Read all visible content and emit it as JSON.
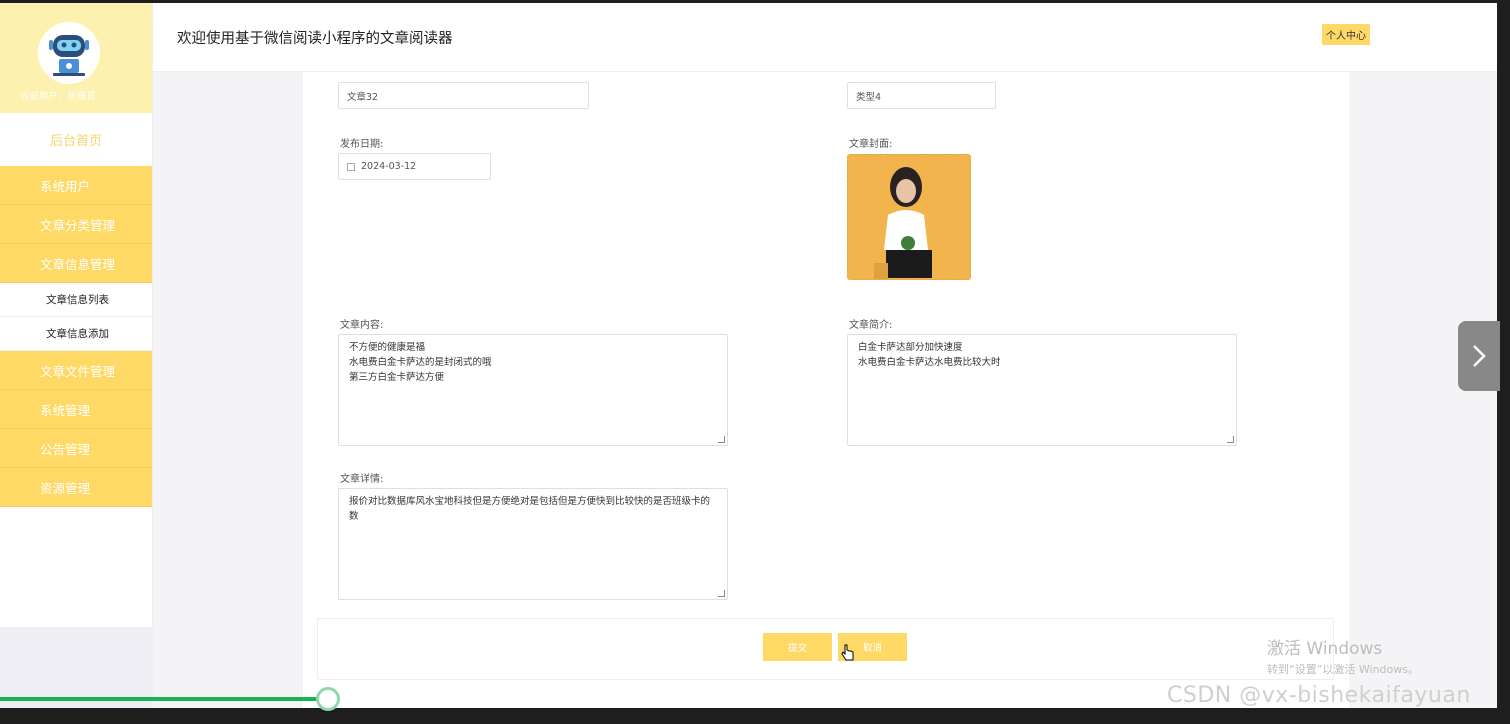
{
  "app": {
    "title": "欢迎使用基于微信阅读小程序的文章阅读器",
    "personal_center": "个人中心"
  },
  "sidebar": {
    "user_line": "当前用户：管理员",
    "home": "后台首页",
    "menu": [
      {
        "label": "系统用户"
      },
      {
        "label": "文章分类管理"
      },
      {
        "label": "文章信息管理"
      }
    ],
    "submenu": [
      {
        "label": "文章信息列表"
      },
      {
        "label": "文章信息添加"
      }
    ],
    "menu2": [
      {
        "label": "文章文件管理"
      },
      {
        "label": "系统管理"
      },
      {
        "label": "公告管理"
      },
      {
        "label": "资源管理"
      }
    ]
  },
  "form": {
    "article_name": "文章32",
    "article_type": "类型4",
    "publish_date_label": "发布日期:",
    "publish_date": "2024-03-12",
    "cover_label": "文章封面:",
    "content_label": "文章内容:",
    "content": "不方便的健康是福\n水电费白金卡萨达的是封闭式的哦\n第三方白金卡萨达方便",
    "intro_label": "文章简介:",
    "intro": "白金卡萨达部分加快速度\n水电费白金卡萨达水电费比较大时",
    "detail_label": "文章详情:",
    "detail": "报价对比数据库风水宝地科技但是方便绝对是包括但是方便快到比较快的是否班级卡的数",
    "submit": "提交",
    "cancel": "取消"
  },
  "overlay": {
    "activate_title": "激活 Windows",
    "activate_sub": "转到“设置”以激活 Windows。",
    "watermark": "CSDN @vx-bishekaifayuan"
  },
  "colors": {
    "accent": "#ffd966",
    "sidebar_head": "#fdf1b0",
    "progress": "#17b454"
  }
}
